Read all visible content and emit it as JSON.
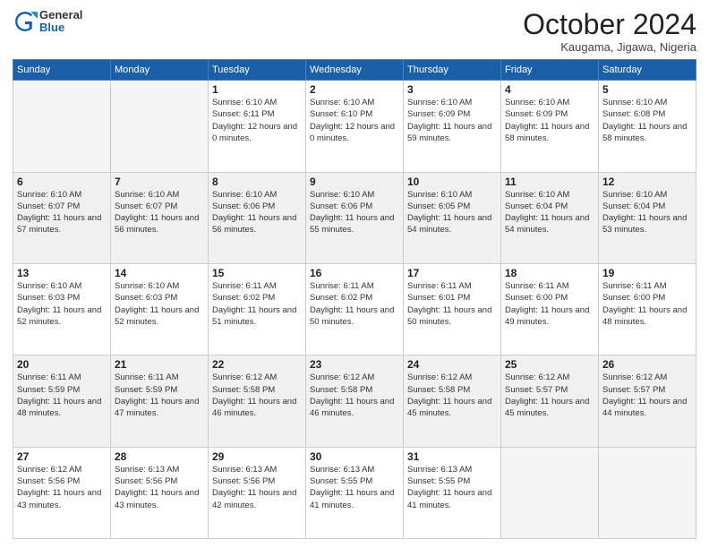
{
  "logo": {
    "general": "General",
    "blue": "Blue"
  },
  "header": {
    "month": "October 2024",
    "location": "Kaugama, Jigawa, Nigeria"
  },
  "weekdays": [
    "Sunday",
    "Monday",
    "Tuesday",
    "Wednesday",
    "Thursday",
    "Friday",
    "Saturday"
  ],
  "weeks": [
    [
      {
        "day": "",
        "info": ""
      },
      {
        "day": "",
        "info": ""
      },
      {
        "day": "1",
        "info": "Sunrise: 6:10 AM\nSunset: 6:11 PM\nDaylight: 12 hours and 0 minutes."
      },
      {
        "day": "2",
        "info": "Sunrise: 6:10 AM\nSunset: 6:10 PM\nDaylight: 12 hours and 0 minutes."
      },
      {
        "day": "3",
        "info": "Sunrise: 6:10 AM\nSunset: 6:09 PM\nDaylight: 11 hours and 59 minutes."
      },
      {
        "day": "4",
        "info": "Sunrise: 6:10 AM\nSunset: 6:09 PM\nDaylight: 11 hours and 58 minutes."
      },
      {
        "day": "5",
        "info": "Sunrise: 6:10 AM\nSunset: 6:08 PM\nDaylight: 11 hours and 58 minutes."
      }
    ],
    [
      {
        "day": "6",
        "info": "Sunrise: 6:10 AM\nSunset: 6:07 PM\nDaylight: 11 hours and 57 minutes."
      },
      {
        "day": "7",
        "info": "Sunrise: 6:10 AM\nSunset: 6:07 PM\nDaylight: 11 hours and 56 minutes."
      },
      {
        "day": "8",
        "info": "Sunrise: 6:10 AM\nSunset: 6:06 PM\nDaylight: 11 hours and 56 minutes."
      },
      {
        "day": "9",
        "info": "Sunrise: 6:10 AM\nSunset: 6:06 PM\nDaylight: 11 hours and 55 minutes."
      },
      {
        "day": "10",
        "info": "Sunrise: 6:10 AM\nSunset: 6:05 PM\nDaylight: 11 hours and 54 minutes."
      },
      {
        "day": "11",
        "info": "Sunrise: 6:10 AM\nSunset: 6:04 PM\nDaylight: 11 hours and 54 minutes."
      },
      {
        "day": "12",
        "info": "Sunrise: 6:10 AM\nSunset: 6:04 PM\nDaylight: 11 hours and 53 minutes."
      }
    ],
    [
      {
        "day": "13",
        "info": "Sunrise: 6:10 AM\nSunset: 6:03 PM\nDaylight: 11 hours and 52 minutes."
      },
      {
        "day": "14",
        "info": "Sunrise: 6:10 AM\nSunset: 6:03 PM\nDaylight: 11 hours and 52 minutes."
      },
      {
        "day": "15",
        "info": "Sunrise: 6:11 AM\nSunset: 6:02 PM\nDaylight: 11 hours and 51 minutes."
      },
      {
        "day": "16",
        "info": "Sunrise: 6:11 AM\nSunset: 6:02 PM\nDaylight: 11 hours and 50 minutes."
      },
      {
        "day": "17",
        "info": "Sunrise: 6:11 AM\nSunset: 6:01 PM\nDaylight: 11 hours and 50 minutes."
      },
      {
        "day": "18",
        "info": "Sunrise: 6:11 AM\nSunset: 6:00 PM\nDaylight: 11 hours and 49 minutes."
      },
      {
        "day": "19",
        "info": "Sunrise: 6:11 AM\nSunset: 6:00 PM\nDaylight: 11 hours and 48 minutes."
      }
    ],
    [
      {
        "day": "20",
        "info": "Sunrise: 6:11 AM\nSunset: 5:59 PM\nDaylight: 11 hours and 48 minutes."
      },
      {
        "day": "21",
        "info": "Sunrise: 6:11 AM\nSunset: 5:59 PM\nDaylight: 11 hours and 47 minutes."
      },
      {
        "day": "22",
        "info": "Sunrise: 6:12 AM\nSunset: 5:58 PM\nDaylight: 11 hours and 46 minutes."
      },
      {
        "day": "23",
        "info": "Sunrise: 6:12 AM\nSunset: 5:58 PM\nDaylight: 11 hours and 46 minutes."
      },
      {
        "day": "24",
        "info": "Sunrise: 6:12 AM\nSunset: 5:58 PM\nDaylight: 11 hours and 45 minutes."
      },
      {
        "day": "25",
        "info": "Sunrise: 6:12 AM\nSunset: 5:57 PM\nDaylight: 11 hours and 45 minutes."
      },
      {
        "day": "26",
        "info": "Sunrise: 6:12 AM\nSunset: 5:57 PM\nDaylight: 11 hours and 44 minutes."
      }
    ],
    [
      {
        "day": "27",
        "info": "Sunrise: 6:12 AM\nSunset: 5:56 PM\nDaylight: 11 hours and 43 minutes."
      },
      {
        "day": "28",
        "info": "Sunrise: 6:13 AM\nSunset: 5:56 PM\nDaylight: 11 hours and 43 minutes."
      },
      {
        "day": "29",
        "info": "Sunrise: 6:13 AM\nSunset: 5:56 PM\nDaylight: 11 hours and 42 minutes."
      },
      {
        "day": "30",
        "info": "Sunrise: 6:13 AM\nSunset: 5:55 PM\nDaylight: 11 hours and 41 minutes."
      },
      {
        "day": "31",
        "info": "Sunrise: 6:13 AM\nSunset: 5:55 PM\nDaylight: 11 hours and 41 minutes."
      },
      {
        "day": "",
        "info": ""
      },
      {
        "day": "",
        "info": ""
      }
    ]
  ]
}
